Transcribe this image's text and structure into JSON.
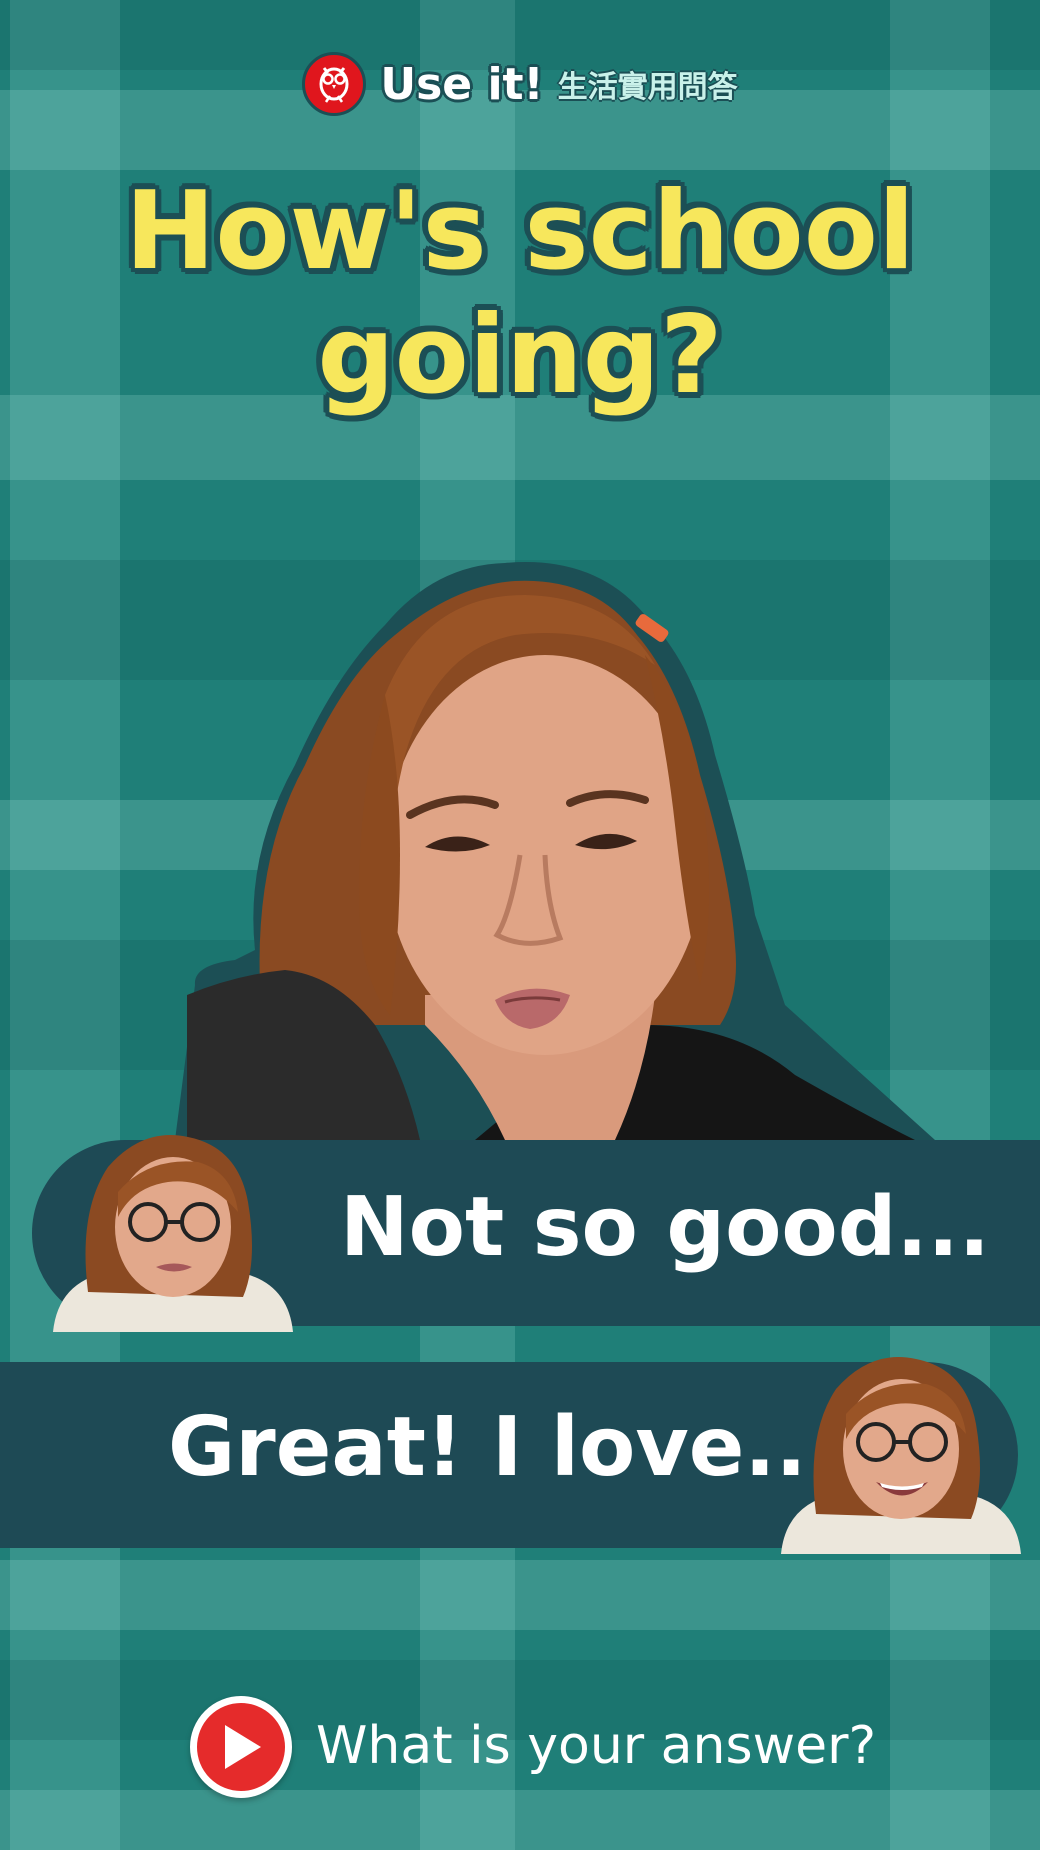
{
  "header": {
    "logo_icon": "owl-logo-icon",
    "brand": "Use it!",
    "brand_sub": "生活實用問答"
  },
  "title": {
    "line1": "How's school",
    "line2": "going?"
  },
  "answers": [
    {
      "text": "Not so good..."
    },
    {
      "text": "Great! I love..."
    }
  ],
  "footer": {
    "play_icon": "play-icon",
    "prompt": "What is your answer?"
  },
  "colors": {
    "background": "#1f7f78",
    "title": "#f7e75c",
    "outline": "#1c4f55",
    "bar": "#1e4a55",
    "logo": "#e0161d",
    "play": "#e52b2b"
  }
}
